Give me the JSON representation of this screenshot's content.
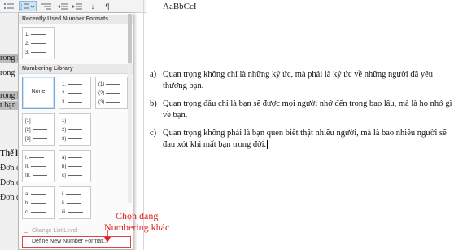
{
  "ribbon": {
    "style_sample": "AaBbCcI",
    "pilcrow": "¶",
    "sort_glyph": "↓"
  },
  "left_fragments": [
    "rong l",
    "rong",
    "rong l",
    "t bạn",
    "Thể l",
    "Đơn c",
    "Đơn c",
    "Đơn c"
  ],
  "dropdown": {
    "recent_header": "Recently Used Number Formats",
    "library_header": "Numbering Library",
    "recent_tile": [
      "1.",
      "2.",
      "3."
    ],
    "none_label": "None",
    "library_tiles": [
      [
        "1.",
        "2.",
        "3."
      ],
      [
        "(1)",
        "(2)",
        "(3)"
      ],
      [
        "[1]",
        "[2]",
        "[3]"
      ],
      [
        "1)",
        "2)",
        "3)"
      ],
      [
        "I.",
        "II.",
        "III."
      ],
      [
        "a)",
        "b)",
        "c)"
      ],
      [
        "a.",
        "b.",
        "c."
      ],
      [
        "i.",
        "ii.",
        "iii."
      ]
    ],
    "change_level": "Change List Level",
    "define_format": "Define New Number Format..."
  },
  "annotation": {
    "line1": "Chọn dạng",
    "line2": "Numbering khác",
    "color": "#e02020"
  },
  "document": {
    "items": [
      {
        "marker": "a)",
        "text": "Quan trọng không chỉ là những ký ức, mà phải là ký ức về những người đã yêu thương bạn."
      },
      {
        "marker": "b)",
        "text": "Quan trọng đâu chỉ là bạn sẽ được mọi người nhớ đến trong bao lâu, mà là họ nhớ gì về bạn."
      },
      {
        "marker": "c)",
        "text": "Quan trọng không phải là bạn quen biết thật nhiều người, mà là bao nhiêu người sẽ đau xót khi mất bạn trong đời."
      }
    ]
  }
}
